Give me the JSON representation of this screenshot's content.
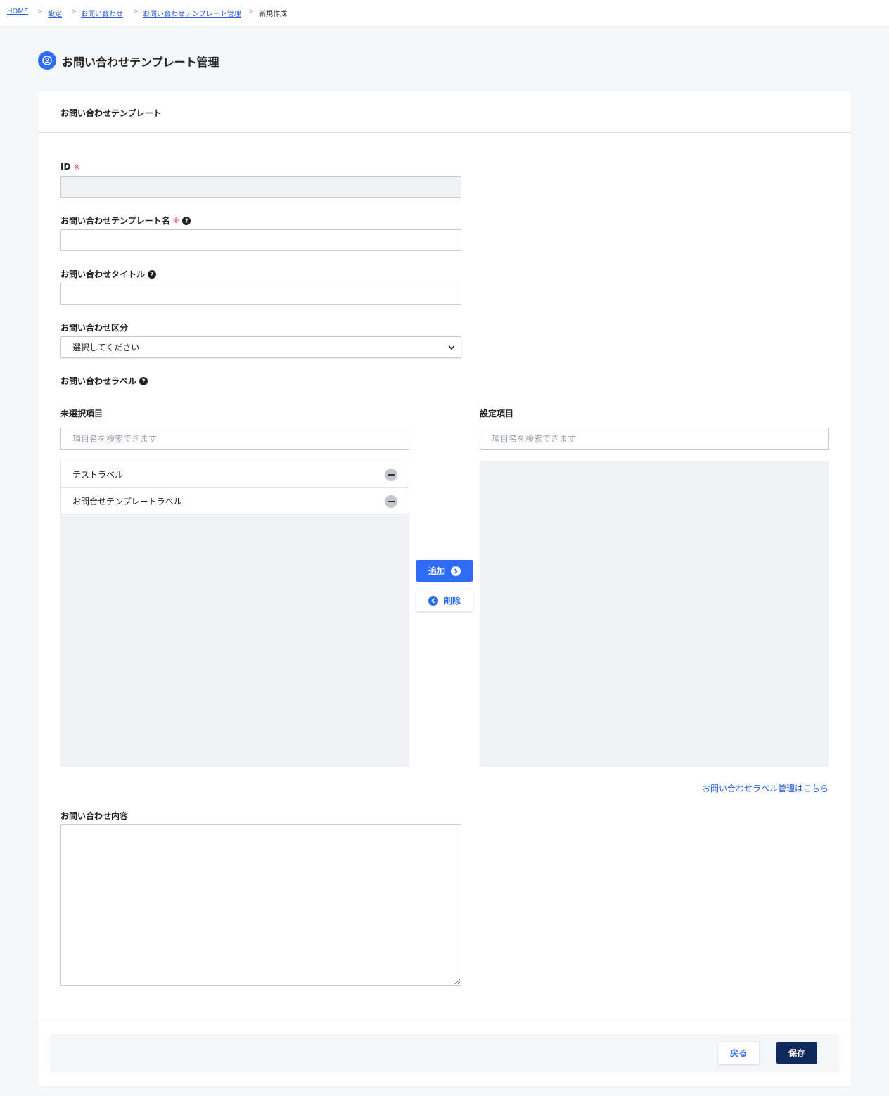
{
  "breadcrumb": {
    "items": [
      "HOME",
      "設定",
      "お問い合わせ",
      "お問い合わせテンプレート管理"
    ],
    "current": "新規作成",
    "separator": ">"
  },
  "page": {
    "title": "お問い合わせテンプレート管理",
    "icon": "user-circle-icon"
  },
  "card": {
    "title": "お問い合わせテンプレート"
  },
  "form": {
    "id": {
      "label": "ID",
      "required_mark": "※",
      "value": ""
    },
    "template_name": {
      "label": "お問い合わせテンプレート名",
      "required_mark": "※",
      "value": ""
    },
    "inquiry_title": {
      "label": "お問い合わせタイトル",
      "value": ""
    },
    "category": {
      "label": "お問い合わせ区分",
      "selected": "選択してください"
    },
    "labels": {
      "label": "お問い合わせラベル",
      "unselected": {
        "title": "未選択項目",
        "search_placeholder": "項目名を検索できます",
        "items": [
          "テストラベル",
          "お問合せテンプレートラベル"
        ]
      },
      "selected": {
        "title": "設定項目",
        "search_placeholder": "項目名を検索できます",
        "items": []
      },
      "add_button": "追加",
      "remove_button": "削除",
      "manage_link": "お問い合わせラベル管理はこちら"
    },
    "content": {
      "label": "お問い合わせ内容",
      "value": ""
    }
  },
  "footer": {
    "back_button": "戻る",
    "save_button": "保存"
  },
  "colors": {
    "primary": "#2f6cf6",
    "save": "#112a5c",
    "required": "#e04848",
    "link": "#2a62d8"
  }
}
